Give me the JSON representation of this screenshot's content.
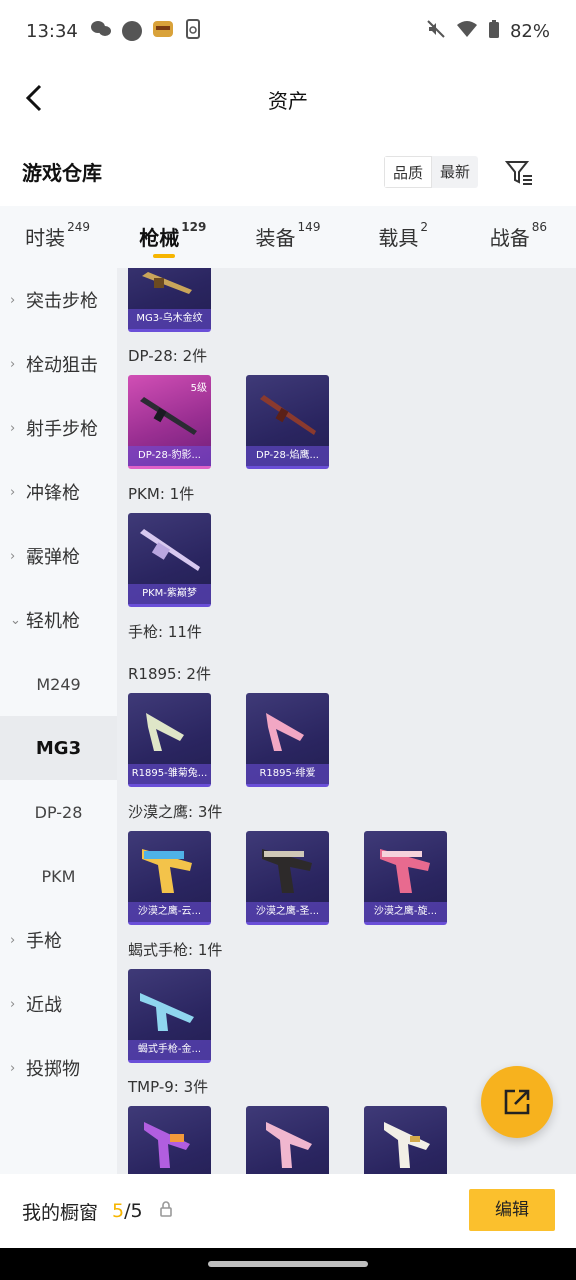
{
  "status": {
    "time": "13:34",
    "battery": "82%"
  },
  "header": {
    "title": "资产"
  },
  "warehouse": {
    "title": "游戏仓库",
    "sort_quality": "品质",
    "sort_latest": "最新"
  },
  "tabs": [
    {
      "label": "时装",
      "count": "249"
    },
    {
      "label": "枪械",
      "count": "129",
      "active": true
    },
    {
      "label": "装备",
      "count": "149"
    },
    {
      "label": "载具",
      "count": "2"
    },
    {
      "label": "战备",
      "count": "86"
    }
  ],
  "sidebar": {
    "items": [
      {
        "label": "突击步枪",
        "chevron": "›"
      },
      {
        "label": "栓动狙击",
        "chevron": "›"
      },
      {
        "label": "射手步枪",
        "chevron": "›"
      },
      {
        "label": "冲锋枪",
        "chevron": "›"
      },
      {
        "label": "霰弹枪",
        "chevron": "›"
      },
      {
        "label": "轻机枪",
        "chevron": "⌄"
      },
      {
        "label": "M249"
      },
      {
        "label": "MG3",
        "active": true
      },
      {
        "label": "DP-28"
      },
      {
        "label": "PKM"
      },
      {
        "label": "手枪",
        "chevron": "›"
      },
      {
        "label": "近战",
        "chevron": "›"
      },
      {
        "label": "投掷物",
        "chevron": "›"
      }
    ]
  },
  "content": {
    "groups": [
      {
        "label": ""
      },
      {
        "label": "DP-28: 2件"
      },
      {
        "label": "PKM: 1件"
      },
      {
        "label": "手枪: 11件"
      },
      {
        "label": "R1895: 2件"
      },
      {
        "label": "沙漠之鹰: 3件"
      },
      {
        "label": "蝎式手枪: 1件"
      },
      {
        "label": "TMP-9: 3件"
      }
    ],
    "cards": [
      {
        "caption": "MG3-乌木金纹"
      },
      {
        "caption": "DP-28-豹影...",
        "level": "5级"
      },
      {
        "caption": "DP-28-焰鹰..."
      },
      {
        "caption": "PKM-紫巅梦"
      },
      {
        "caption": "R1895-雏菊兔..."
      },
      {
        "caption": "R1895-绯爱"
      },
      {
        "caption": "沙漠之鹰-云..."
      },
      {
        "caption": "沙漠之鹰-圣..."
      },
      {
        "caption": "沙漠之鹰-旋..."
      },
      {
        "caption": "蝎式手枪-金..."
      },
      {
        "caption": ""
      },
      {
        "caption": ""
      },
      {
        "caption": ""
      }
    ]
  },
  "bottom": {
    "label": "我的橱窗",
    "count_used": "5",
    "count_sep_total": "/5",
    "edit_label": "编辑"
  },
  "colors": {
    "accent": "#f6b500",
    "fab": "#f7b21e",
    "card_purple": "#2a2560",
    "card_pink": "#c044a8"
  }
}
